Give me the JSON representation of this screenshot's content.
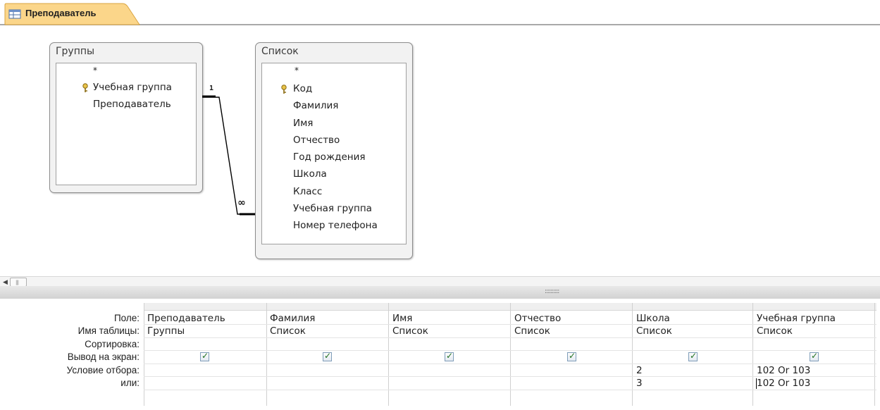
{
  "document_tab": {
    "label": "Преподаватель",
    "icon": "query-icon"
  },
  "tables": {
    "gruppy": {
      "title": "Группы",
      "fields": [
        "*",
        "Учебная группа",
        "Преподаватель"
      ],
      "primary_key": "Учебная группа"
    },
    "spisok": {
      "title": "Список",
      "fields": [
        "*",
        "Код",
        "Фамилия",
        "Имя",
        "Отчество",
        "Год рождения",
        "Школа",
        "Класс",
        "Учебная группа",
        "Номер телефона"
      ],
      "primary_key": "Код"
    }
  },
  "relationship": {
    "one_side": "1",
    "many_side": "∞"
  },
  "grid": {
    "row_labels": {
      "field": "Поле:",
      "table": "Имя таблицы:",
      "sort": "Сортировка:",
      "show": "Вывод на экран:",
      "criteria": "Условие отбора:",
      "or": "или:"
    },
    "columns": [
      {
        "field": "Преподаватель",
        "table": "Группы",
        "sort": "",
        "show": true,
        "criteria": "",
        "or": ""
      },
      {
        "field": "Фамилия",
        "table": "Список",
        "sort": "",
        "show": true,
        "criteria": "",
        "or": ""
      },
      {
        "field": "Имя",
        "table": "Список",
        "sort": "",
        "show": true,
        "criteria": "",
        "or": ""
      },
      {
        "field": "Отчество",
        "table": "Список",
        "sort": "",
        "show": true,
        "criteria": "",
        "or": ""
      },
      {
        "field": "Школа",
        "table": "Список",
        "sort": "",
        "show": true,
        "criteria": "2",
        "or": "3"
      },
      {
        "field": "Учебная группа",
        "table": "Список",
        "sort": "",
        "show": true,
        "criteria": "102 Or 103",
        "or": "102 Or 103"
      }
    ]
  },
  "colors": {
    "tab_fill": "#fbd68a",
    "tab_border": "#d9a441",
    "checkbox_check": "#1e6f1e"
  }
}
